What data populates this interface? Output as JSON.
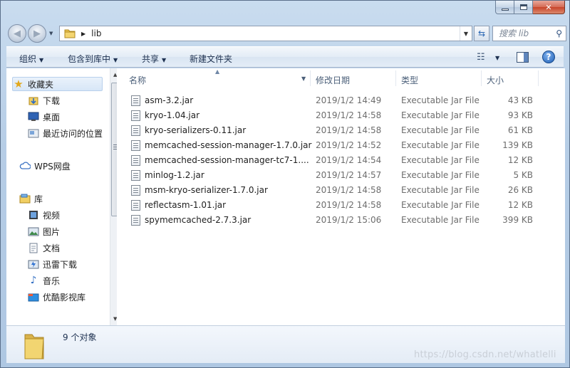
{
  "window": {
    "caption_buttons": [
      "minimize",
      "maximize",
      "close"
    ]
  },
  "address_bar": {
    "breadcrumb": [
      "lib"
    ],
    "search_placeholder": "搜索 lib"
  },
  "toolbar": {
    "organize": "组织",
    "include_in_library": "包含到库中",
    "share": "共享",
    "new_folder": "新建文件夹"
  },
  "nav_pane": {
    "favorites": "收藏夹",
    "downloads": "下载",
    "desktop": "桌面",
    "recent": "最近访问的位置",
    "wps": "WPS网盘",
    "libraries": "库",
    "videos": "视频",
    "pictures": "图片",
    "documents": "文档",
    "thunder": "迅雷下载",
    "music": "音乐",
    "youku": "优酷影视库"
  },
  "columns": {
    "name": "名称",
    "date": "修改日期",
    "type": "类型",
    "size": "大小"
  },
  "files": [
    {
      "name": "asm-3.2.jar",
      "date": "2019/1/2 14:49",
      "type": "Executable Jar File",
      "size": "43 KB"
    },
    {
      "name": "kryo-1.04.jar",
      "date": "2019/1/2 14:58",
      "type": "Executable Jar File",
      "size": "93 KB"
    },
    {
      "name": "kryo-serializers-0.11.jar",
      "date": "2019/1/2 14:58",
      "type": "Executable Jar File",
      "size": "61 KB"
    },
    {
      "name": "memcached-session-manager-1.7.0.jar",
      "date": "2019/1/2 14:52",
      "type": "Executable Jar File",
      "size": "139 KB"
    },
    {
      "name": "memcached-session-manager-tc7-1....",
      "date": "2019/1/2 14:54",
      "type": "Executable Jar File",
      "size": "12 KB"
    },
    {
      "name": "minlog-1.2.jar",
      "date": "2019/1/2 14:57",
      "type": "Executable Jar File",
      "size": "5 KB"
    },
    {
      "name": "msm-kryo-serializer-1.7.0.jar",
      "date": "2019/1/2 14:58",
      "type": "Executable Jar File",
      "size": "26 KB"
    },
    {
      "name": "reflectasm-1.01.jar",
      "date": "2019/1/2 14:58",
      "type": "Executable Jar File",
      "size": "12 KB"
    },
    {
      "name": "spymemcached-2.7.3.jar",
      "date": "2019/1/2 15:06",
      "type": "Executable Jar File",
      "size": "399 KB"
    }
  ],
  "status": {
    "item_count": "9 个对象"
  },
  "watermark": "https://blog.csdn.net/whatlelli"
}
